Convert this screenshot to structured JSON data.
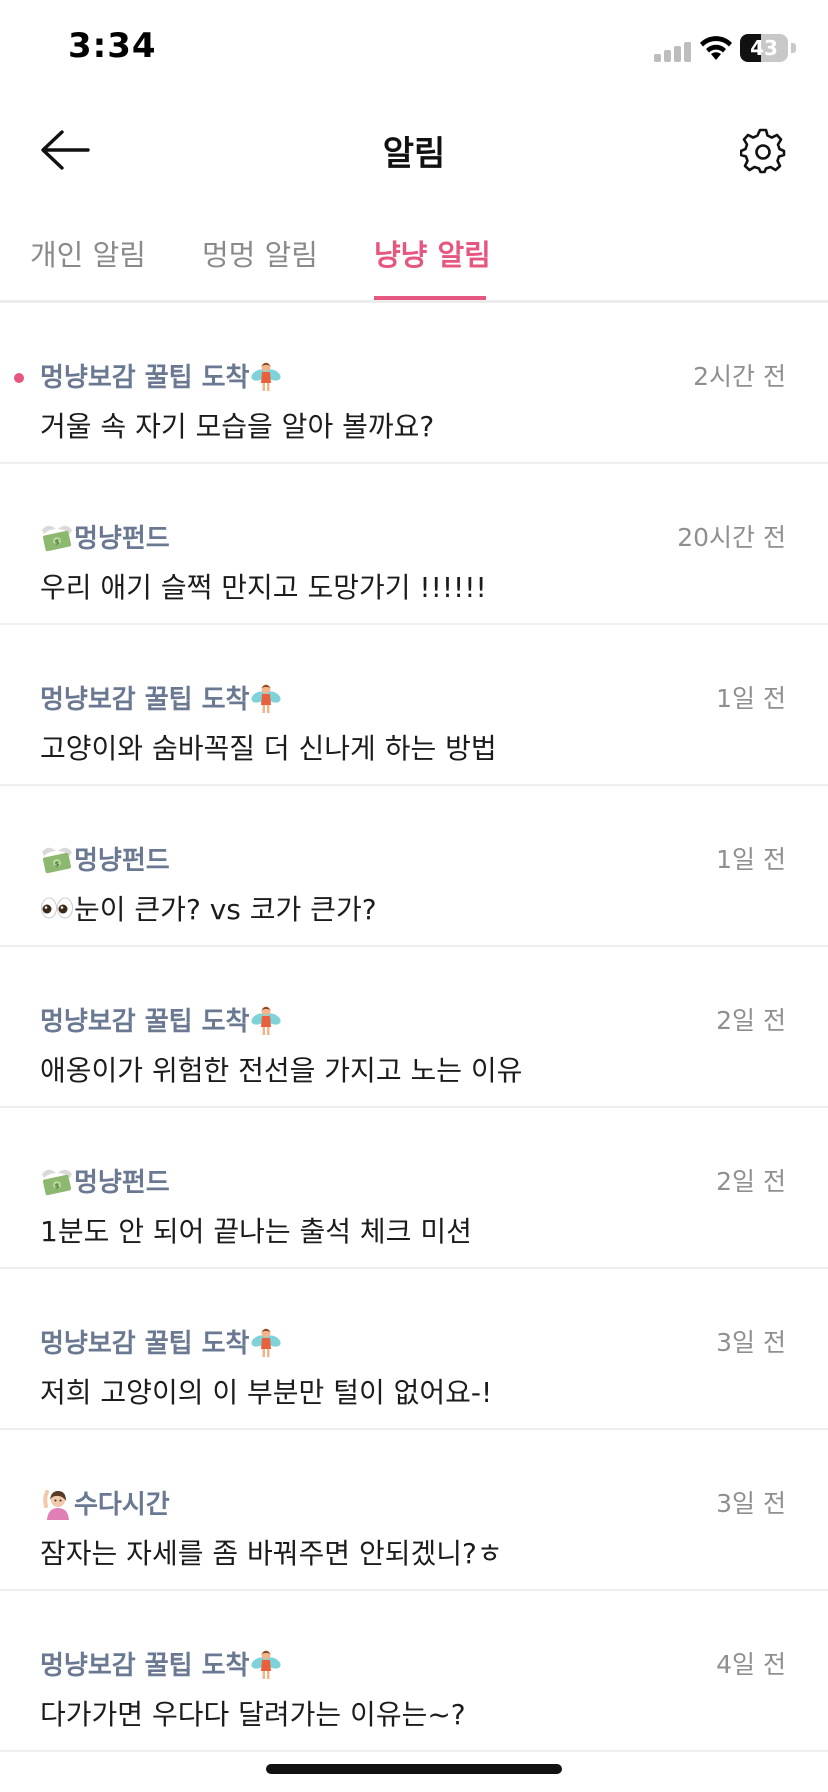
{
  "status_bar": {
    "time": "3:34",
    "battery_percent": "43",
    "battery_level": 0.43
  },
  "header": {
    "title": "알림",
    "back_icon": "arrow-left-icon",
    "settings_icon": "gear-icon"
  },
  "tabs": [
    {
      "label": "개인 알림",
      "active": false
    },
    {
      "label": "멍멍 알림",
      "active": false
    },
    {
      "label": "냥냥 알림",
      "active": true
    }
  ],
  "notifications": [
    {
      "category": "멍냥보감 꿀팁 도착",
      "category_icon": "fairy-icon",
      "time": "2시간 전",
      "message": "거울 속 자기 모습을 알아 볼까요?",
      "unread": true
    },
    {
      "category": "멍냥펀드",
      "category_icon": "money-wings-icon",
      "time": "20시간 전",
      "message": "우리 애기 슬쩍 만지고 도망가기 !!!!!!",
      "unread": false
    },
    {
      "category": "멍냥보감 꿀팁 도착",
      "category_icon": "fairy-icon",
      "time": "1일 전",
      "message": "고양이와 숨바꼭질 더 신나게 하는 방법",
      "unread": false
    },
    {
      "category": "멍냥펀드",
      "category_icon": "money-wings-icon",
      "time": "1일 전",
      "message": "눈이 큰가? vs 코가 큰가?",
      "message_icon": "eyes-icon",
      "unread": false
    },
    {
      "category": "멍냥보감 꿀팁 도착",
      "category_icon": "fairy-icon",
      "time": "2일 전",
      "message": "애옹이가 위험한 전선을 가지고 노는 이유",
      "unread": false
    },
    {
      "category": "멍냥펀드",
      "category_icon": "money-wings-icon",
      "time": "2일 전",
      "message": "1분도 안 되어 끝나는 출석 체크 미션",
      "unread": false
    },
    {
      "category": "멍냥보감 꿀팁 도착",
      "category_icon": "fairy-icon",
      "time": "3일 전",
      "message": "저희 고양이의 이 부분만 털이 없어요-!",
      "unread": false
    },
    {
      "category": "수다시간",
      "category_icon": "raising-hand-icon",
      "time": "3일 전",
      "message": "잠자는 자세를 좀 바꿔주면 안되겠니?ㅎ",
      "unread": false
    },
    {
      "category": "멍냥보감 꿀팁 도착",
      "category_icon": "fairy-icon",
      "time": "4일 전",
      "message": "다가가면 우다다 달려가는 이유는~?",
      "unread": false
    }
  ],
  "colors": {
    "accent": "#e5577e",
    "category_text": "#6a7891",
    "time_text": "#8f8f8f",
    "inactive_tab": "#8a8a8a"
  }
}
